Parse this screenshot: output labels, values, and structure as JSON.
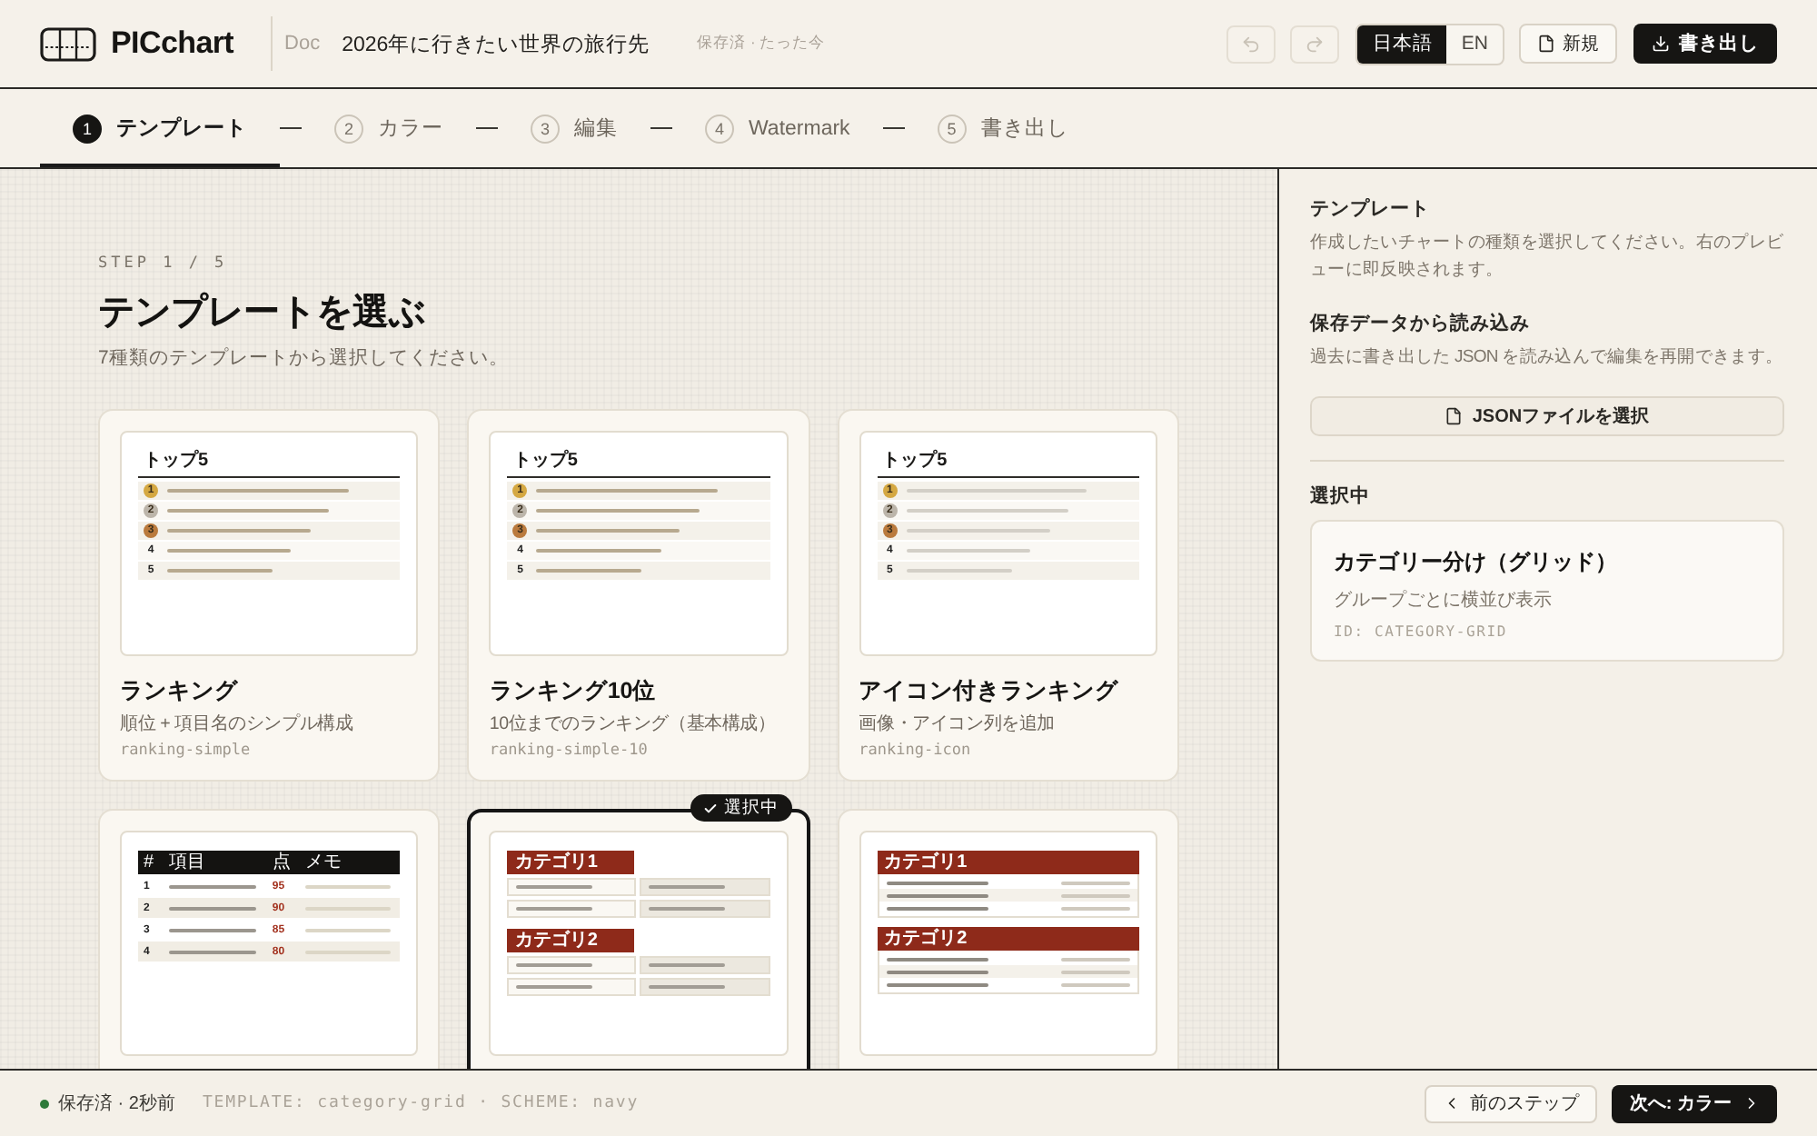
{
  "header": {
    "logo": "**PIC**chart",
    "doc_label": "Doc",
    "doc_title": "2026年に行きたい世界の旅行先",
    "save_status": "保存済 · たった今",
    "undo": {
      "disabled": true
    },
    "redo": {
      "disabled": true
    },
    "languages": [
      {
        "label": "日本語",
        "selected": true
      },
      {
        "label": "EN",
        "selected": false
      }
    ],
    "new_button": "新規",
    "export_button": "書き出し"
  },
  "steps": [
    {
      "number": "1",
      "label": "テンプレート",
      "selected": true
    },
    {
      "number": "2",
      "label": "カラー",
      "selected": false
    },
    {
      "number": "3",
      "label": "編集",
      "selected": false
    },
    {
      "number": "4",
      "label": "Watermark",
      "selected": false
    },
    {
      "number": "5",
      "label": "書き出し",
      "selected": false
    }
  ],
  "main": {
    "step_label": "STEP 1 / 5",
    "title": "テンプレートを選ぶ",
    "subtitle": "7種類のテンプレートから選択してください。",
    "selected_badge": "選択中",
    "templates": [
      {
        "title": "ランキング",
        "description": "順位 + 項目名のシンプル構成",
        "id": "ranking-simple",
        "selected": false,
        "preview": {
          "kind": "ranking",
          "heading": "トップ5",
          "rows": [
            {
              "rank": "1",
              "color": "#d5a842"
            },
            {
              "rank": "2",
              "color": "#bcb5aa"
            },
            {
              "rank": "3",
              "color": "#ba7a3d"
            },
            {
              "rank": "4"
            },
            {
              "rank": "5"
            }
          ]
        }
      },
      {
        "title": "ランキング10位",
        "description": "10位までのランキング（基本構成）",
        "id": "ranking-simple-10",
        "selected": false,
        "preview": {
          "kind": "ranking",
          "heading": "トップ5",
          "rows": [
            {
              "rank": "1",
              "color": "#d5a842"
            },
            {
              "rank": "2",
              "color": "#bcb5aa"
            },
            {
              "rank": "3",
              "color": "#ba7a3d"
            },
            {
              "rank": "4"
            },
            {
              "rank": "5"
            }
          ]
        }
      },
      {
        "title": "アイコン付きランキング",
        "description": "画像・アイコン列を追加",
        "id": "ranking-icon",
        "selected": false,
        "preview": {
          "kind": "ranking-light",
          "heading": "トップ5",
          "rows": [
            {
              "rank": "1",
              "color": "#d5a842"
            },
            {
              "rank": "2",
              "color": "#bcb5aa"
            },
            {
              "rank": "3",
              "color": "#ba7a3d"
            },
            {
              "rank": "4"
            },
            {
              "rank": "5"
            }
          ]
        }
      },
      {
        "selected": false,
        "preview": {
          "kind": "table",
          "columns": [
            "#",
            "項目",
            "点",
            "メモ"
          ],
          "rows": [
            {
              "rank": "1",
              "score": "95"
            },
            {
              "rank": "2",
              "score": "90"
            },
            {
              "rank": "3",
              "score": "85"
            },
            {
              "rank": "4",
              "score": "80"
            }
          ]
        }
      },
      {
        "selected": true,
        "preview": {
          "kind": "category-grid",
          "categories": [
            {
              "name": "カテゴリ1"
            },
            {
              "name": "カテゴリ2"
            }
          ]
        }
      },
      {
        "selected": false,
        "preview": {
          "kind": "category-list",
          "categories": [
            {
              "name": "カテゴリ1"
            },
            {
              "name": "カテゴリ2"
            }
          ]
        }
      }
    ]
  },
  "side_panel": {
    "sections": [
      {
        "heading": "テンプレート",
        "text": "作成したいチャートの種類を選択してください。右のプレビューに即反映されます。"
      },
      {
        "heading": "保存データから読み込み",
        "text": "過去に書き出した JSON を読み込んで編集を再開できます。"
      }
    ],
    "file_button": "JSONファイルを選択",
    "selected_heading": "選択中",
    "selected_card": {
      "title": "カテゴリー分け（グリッド）",
      "description": "グループごとに横並び表示",
      "id": "ID: CATEGORY-GRID"
    }
  },
  "footer": {
    "save_status": "保存済 · 2秒前",
    "meta": "TEMPLATE: category-grid · SCHEME: navy",
    "prev_button": "前のステップ",
    "next_button": "次へ: カラー"
  }
}
